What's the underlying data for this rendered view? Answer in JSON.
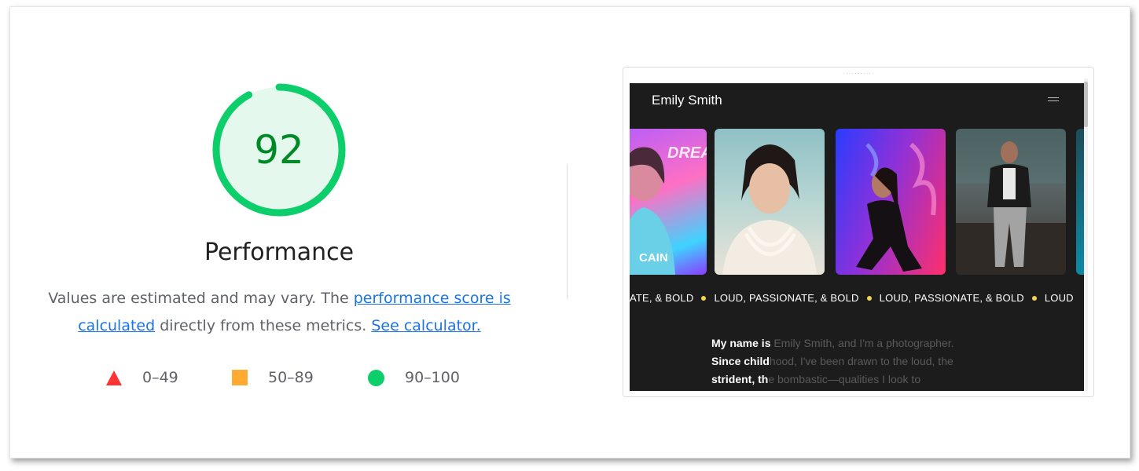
{
  "score": {
    "value": "92",
    "fraction": 0.92,
    "ring_color": "#0cce6b",
    "track_color": "#e5f8ee",
    "text_color": "#008a26"
  },
  "title": "Performance",
  "description": {
    "prefix": "Values are estimated and may vary. The ",
    "link1": "performance score is calculated",
    "middle": " directly from these metrics. ",
    "link2": "See calculator."
  },
  "legend": [
    {
      "shape": "triangle-icon",
      "label": "0–49",
      "color": "#ff3333"
    },
    {
      "shape": "square-icon",
      "label": "50–89",
      "color": "#ffaa33"
    },
    {
      "shape": "circle-icon",
      "label": "90–100",
      "color": "#0cce6b"
    }
  ],
  "screenshot": {
    "site_name": "Emily Smith",
    "marquee": [
      "ATE, & BOLD",
      "LOUD, PASSIONATE, & BOLD",
      "LOUD, PASSIONATE, & BOLD",
      "LOUD"
    ],
    "photo1_text_top": "DREA",
    "photo1_text_bottom": "CAIN",
    "bio": [
      {
        "bright": "My name is",
        "dim": " Emily Smith, and I'm a photographer."
      },
      {
        "bright": "Since child",
        "dim": "hood, I've been drawn to the loud, the"
      },
      {
        "bright": "strident, th",
        "dim": "e bombastic—qualities I look to"
      }
    ]
  }
}
